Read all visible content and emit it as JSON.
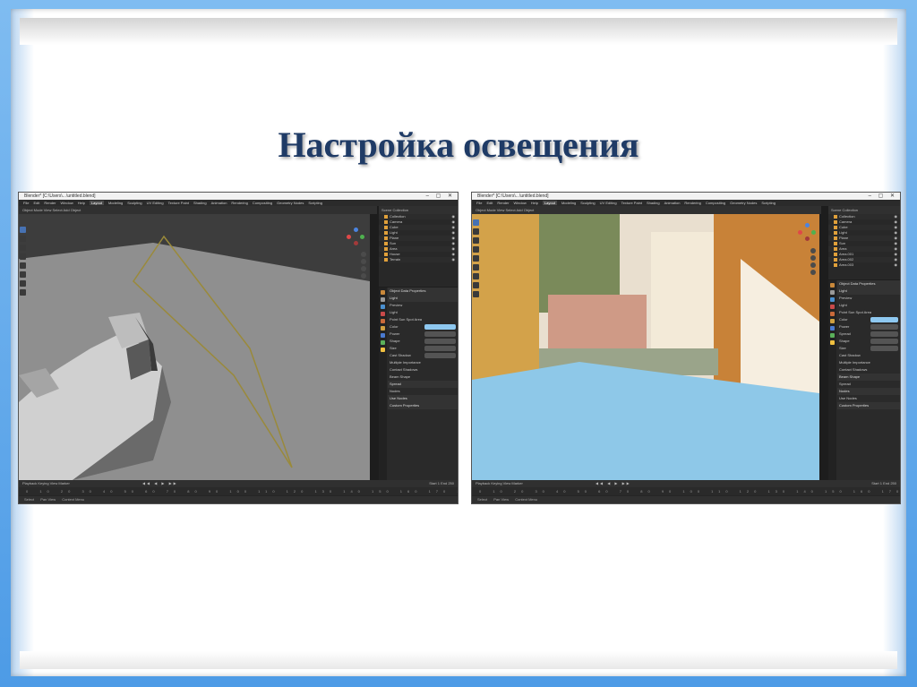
{
  "slide": {
    "title": "Настройка освещения"
  },
  "left_shot": {
    "window_title": "Blender* [C:\\Users\\...\\untitled.blend]",
    "menus": [
      "File",
      "Edit",
      "Render",
      "Window",
      "Help",
      "Layout",
      "Modeling",
      "Sculpting",
      "UV Editing",
      "Texture Paint",
      "Shading",
      "Animation",
      "Rendering",
      "Compositing",
      "Geometry Nodes",
      "Scripting"
    ],
    "active_menu": "Layout",
    "viewport_header": "Object Mode   View   Select   Add   Object",
    "outliner_header": "Scene Collection",
    "outliner_rows": [
      "Collection",
      "Camera",
      "Cube",
      "Light",
      "Plane",
      "Sun",
      "Area",
      "House",
      "Terrain"
    ],
    "props": {
      "header": "Object Data Properties",
      "rows": [
        "Light",
        "Preview",
        "Light",
        "Point   Sun   Spot   Area",
        "Color",
        "Power",
        "Shape",
        "Size",
        "Cast Shadow",
        "Multiple Importance",
        "Contact Shadows",
        "Beam Shape",
        "Spread",
        "Nodes",
        "Use Nodes",
        "Custom Properties"
      ]
    },
    "timeline_header": "Playback  Keying  View  Marker",
    "timeline_right": "Start 1   End 250",
    "ruler": "0 10 20 30 40 50 60 70 80 90 100 110 120 130 140 150 160 170 180 190 200 210 220 230 240 250",
    "status": [
      "Select",
      "Pan View",
      "Context Menu"
    ]
  },
  "right_shot": {
    "window_title": "Blender* [C:\\Users\\...\\untitled.blend]",
    "menus": [
      "File",
      "Edit",
      "Render",
      "Window",
      "Help",
      "Layout",
      "Modeling",
      "Sculpting",
      "UV Editing",
      "Texture Paint",
      "Shading",
      "Animation",
      "Rendering",
      "Compositing",
      "Geometry Nodes",
      "Scripting"
    ],
    "active_menu": "Layout",
    "viewport_header": "Object Mode   View   Select   Add   Object",
    "outliner_header": "Scene Collection",
    "outliner_rows": [
      "Collection",
      "Camera",
      "Cube",
      "Light",
      "Plane",
      "Sun",
      "Area",
      "Area.001",
      "Area.002",
      "Area.003"
    ],
    "props": {
      "header": "Object Data Properties",
      "rows": [
        "Light",
        "Preview",
        "Light",
        "Point   Sun   Spot   Area",
        "Color",
        "Power",
        "Spread",
        "Shape",
        "Size",
        "Cast Shadow",
        "Multiple Importance",
        "Contact Shadows",
        "Beam Shape",
        "Spread",
        "Nodes",
        "Use Nodes",
        "Custom Properties"
      ]
    },
    "timeline_header": "Playback  Keying  View  Marker",
    "timeline_right": "Start 1   End 250",
    "ruler": "0 10 20 30 40 50 60 70 80 90 100 110 120 130 140 150 160 170 180 190 200 210 220 230 240 250",
    "status": [
      "Select",
      "Pan View",
      "Context Menu"
    ]
  },
  "colors": {
    "frame_blue": "#5aa6ec",
    "title_color": "#1f3b66",
    "floor_blue": "#8ec8e8",
    "light_wire": "#9a8a3a"
  }
}
